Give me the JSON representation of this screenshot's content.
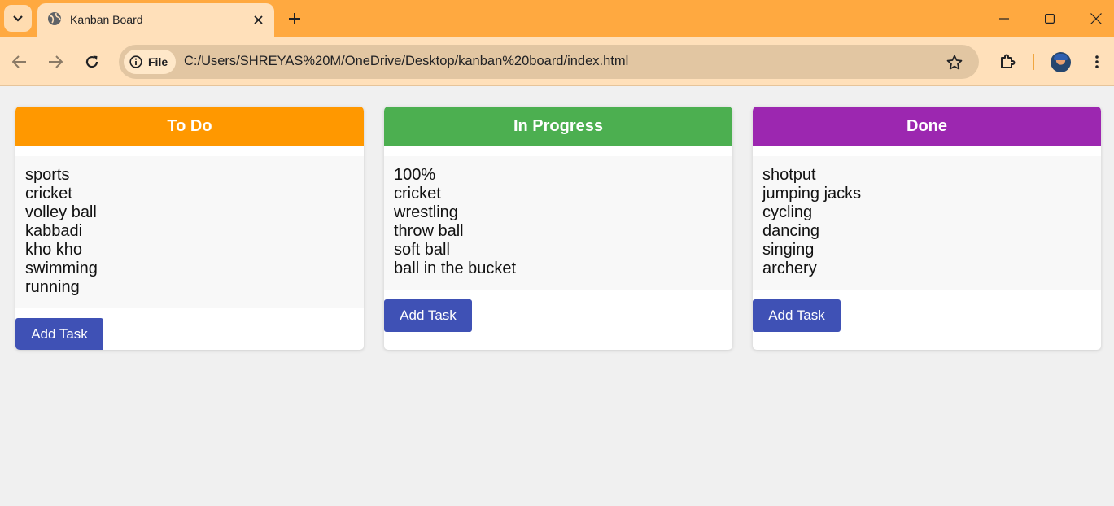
{
  "browser": {
    "tab_title": "Kanban Board",
    "address_chip": "File",
    "url": "C:/Users/SHREYAS%20M/OneDrive/Desktop/kanban%20board/index.html",
    "theme_color": "#ffa940"
  },
  "board": {
    "columns": [
      {
        "title": "To Do",
        "color": "#ff9800",
        "tasks": [
          "sports",
          "cricket",
          "volley ball",
          "kabbadi",
          "kho kho",
          "swimming",
          "running"
        ],
        "button_label": "Add Task"
      },
      {
        "title": "In Progress",
        "color": "#4caf50",
        "tasks": [
          "100%",
          "cricket",
          "wrestling",
          "throw ball",
          "soft ball",
          "ball in the bucket"
        ],
        "button_label": "Add Task"
      },
      {
        "title": "Done",
        "color": "#9c27b0",
        "tasks": [
          "shotput",
          "jumping jacks",
          "cycling",
          "dancing",
          "singing",
          "archery"
        ],
        "button_label": "Add Task"
      }
    ],
    "button_color": "#3f51b5"
  }
}
